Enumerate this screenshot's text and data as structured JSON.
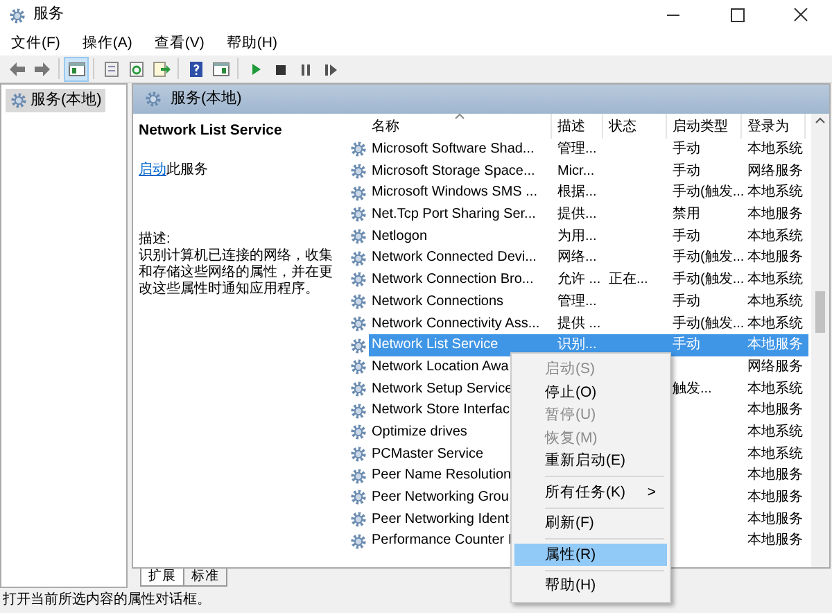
{
  "window": {
    "title": "服务"
  },
  "menu_bar": [
    "文件(F)",
    "操作(A)",
    "查看(V)",
    "帮助(H)"
  ],
  "toolbar": [
    {
      "pressed": false
    },
    {
      "pressed": false
    },
    {
      "pressed": true
    },
    {
      "pressed": false
    },
    {
      "pressed": false
    },
    {
      "pressed": false
    },
    {
      "pressed": false
    },
    {
      "pressed": false
    },
    {
      "pressed": false
    },
    {
      "pressed": false
    },
    {
      "pressed": false
    },
    {
      "pressed": false
    }
  ],
  "tree": {
    "items": [
      {
        "label": "服务(本地)",
        "selected": true
      }
    ]
  },
  "pane": {
    "title": "服务(本地)"
  },
  "details": {
    "service_name": "Network List Service",
    "action_link": "启动",
    "action_text": "此服务",
    "description_label": "描述:",
    "description": "识别计算机已连接的网络，收集和存储这些网络的属性，并在更改这些属性时通知应用程序。"
  },
  "table": {
    "columns": [
      {
        "label": "名称",
        "sorted": true
      },
      {
        "label": "描述",
        "sorted": false
      },
      {
        "label": "状态",
        "sorted": false
      },
      {
        "label": "启动类型",
        "sorted": false
      },
      {
        "label": "登录为",
        "sorted": false
      }
    ],
    "rows": [
      {
        "name": "Microsoft Software Shad...",
        "description": "管理...",
        "startup_type": "手动",
        "log_on_as": "本地系统",
        "selected": false
      },
      {
        "name": "Microsoft Storage Space...",
        "description": "Micr...",
        "startup_type": "手动",
        "log_on_as": "网络服务",
        "selected": false
      },
      {
        "name": "Microsoft Windows SMS ...",
        "description": "根据...",
        "startup_type": "手动(触发...",
        "log_on_as": "本地系统",
        "selected": false
      },
      {
        "name": "Net.Tcp Port Sharing Ser...",
        "description": "提供...",
        "startup_type": "禁用",
        "log_on_as": "本地服务",
        "selected": false
      },
      {
        "name": "Netlogon",
        "description": "为用...",
        "startup_type": "手动",
        "log_on_as": "本地系统",
        "selected": false
      },
      {
        "name": "Network Connected Devi...",
        "description": "网络...",
        "startup_type": "手动(触发...",
        "log_on_as": "本地服务",
        "selected": false
      },
      {
        "name": "Network Connection Bro...",
        "description": "允许 ...",
        "status": "正在...",
        "startup_type": "手动(触发...",
        "log_on_as": "本地系统",
        "selected": false
      },
      {
        "name": "Network Connections",
        "description": "管理...",
        "startup_type": "手动",
        "log_on_as": "本地系统",
        "selected": false
      },
      {
        "name": "Network Connectivity Ass...",
        "description": "提供 ...",
        "startup_type": "手动(触发...",
        "log_on_as": "本地系统",
        "selected": false
      },
      {
        "name": "Network List Service",
        "description": "识别...",
        "startup_type": "手动",
        "log_on_as": "本地服务",
        "selected": true
      },
      {
        "name": "Network Location Awa",
        "log_on_as": "网络服务",
        "selected": false
      },
      {
        "name": "Network Setup Service",
        "startup_type": "触发...",
        "log_on_as": "本地系统",
        "selected": false
      },
      {
        "name": "Network Store Interfac",
        "log_on_as": "本地服务",
        "selected": false
      },
      {
        "name": "Optimize drives",
        "log_on_as": "本地系统",
        "selected": false
      },
      {
        "name": "PCMaster Service",
        "log_on_as": "本地系统",
        "selected": false
      },
      {
        "name": "Peer Name Resolution",
        "log_on_as": "本地服务",
        "selected": false
      },
      {
        "name": "Peer Networking Grou",
        "log_on_as": "本地服务",
        "selected": false
      },
      {
        "name": "Peer Networking Ident",
        "log_on_as": "本地服务",
        "selected": false
      },
      {
        "name": "Performance Counter I",
        "log_on_as": "本地服务",
        "selected": false
      }
    ]
  },
  "context_menu": [
    {
      "kind": "item",
      "label": "启动(S)",
      "disabled": true,
      "selected": false
    },
    {
      "kind": "item",
      "label": "停止(O)",
      "disabled": false,
      "selected": false
    },
    {
      "kind": "item",
      "label": "暂停(U)",
      "disabled": true,
      "selected": false
    },
    {
      "kind": "item",
      "label": "恢复(M)",
      "disabled": true,
      "selected": false
    },
    {
      "kind": "item",
      "label": "重新启动(E)",
      "disabled": false,
      "selected": false
    },
    {
      "kind": "separator"
    },
    {
      "kind": "submenu",
      "label": "所有任务(K)",
      "arrow": ">",
      "disabled": false,
      "selected": false
    },
    {
      "kind": "separator"
    },
    {
      "kind": "item",
      "label": "刷新(F)",
      "disabled": false,
      "selected": false
    },
    {
      "kind": "separator"
    },
    {
      "kind": "item",
      "label": "属性(R)",
      "disabled": false,
      "selected": true
    },
    {
      "kind": "separator"
    },
    {
      "kind": "item",
      "label": "帮助(H)",
      "disabled": false,
      "selected": false
    }
  ],
  "tabs": [
    {
      "label": "扩展",
      "selected": true
    },
    {
      "label": "标准",
      "selected": false
    }
  ],
  "status_bar": "打开当前所选内容的属性对话框。"
}
